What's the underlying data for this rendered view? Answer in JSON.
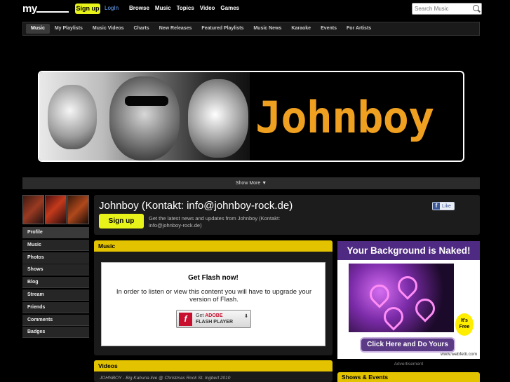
{
  "topbar": {
    "logo": "my",
    "signup_label": "Sign up",
    "login_label": "LogIn",
    "nav": [
      "Browse",
      "Music",
      "Topics",
      "Video",
      "Games"
    ],
    "search_placeholder": "Search Music"
  },
  "subnav": {
    "items": [
      "Music",
      "My Playlists",
      "Music Videos",
      "Charts",
      "New Releases",
      "Featured Playlists",
      "Music News",
      "Karaoke",
      "Events",
      "For Artists"
    ],
    "active": "Music"
  },
  "banner": {
    "band_name": "Johnboy",
    "show_more": "Show More ▼"
  },
  "sidebar": {
    "items": [
      "Profile",
      "Music",
      "Photos",
      "Shows",
      "Blog",
      "Stream",
      "Friends",
      "Comments",
      "Badges"
    ]
  },
  "profile": {
    "title": "Johnboy (Kontakt: info@johnboy-rock.de)",
    "signup_label": "Sign up",
    "follow_text": "Get the latest news and updates from Johnboy (Kontakt: info@johnboy-rock.de)",
    "like_label": "Like"
  },
  "music_panel": {
    "title": "Music",
    "flash_title": "Get Flash now!",
    "flash_message": "In order to listen or view this content you will have to upgrade your version of Flash.",
    "flash_button": {
      "get": "Get",
      "adobe": "ADOBE",
      "player": "FLASH PLAYER"
    }
  },
  "videos_panel": {
    "title": "Videos",
    "first_item": "JOHNBOY - Big Kahuna live @ Christmas Rock St. Ingbert 2010"
  },
  "ad": {
    "headline": "Your Background is Naked!",
    "badge": "It's Free",
    "cta": "Click Here and Do Yours",
    "url": "www.webfetti.com",
    "label": "Advertisement"
  },
  "shows_panel": {
    "title": "Shows & Events"
  },
  "colors": {
    "accent_yellow": "#e3c300",
    "signup_yellow": "#e8f31a",
    "band_orange": "#f0a020",
    "ad_purple": "#4f2a82"
  }
}
